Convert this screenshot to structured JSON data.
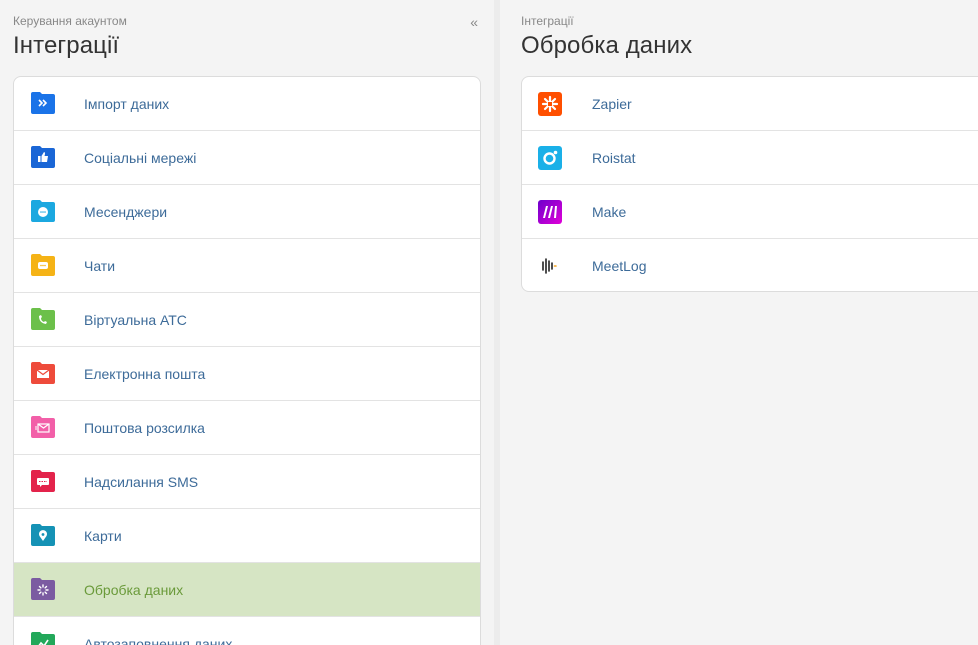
{
  "left": {
    "breadcrumb": "Керування акаунтом",
    "title": "Інтеграції",
    "collapse_icon": "«",
    "items": [
      {
        "label": "Імпорт даних",
        "icon": "import-icon",
        "color": "#1a73e8"
      },
      {
        "label": "Соціальні мережі",
        "icon": "social-icon",
        "color": "#1a66d6"
      },
      {
        "label": "Месенджери",
        "icon": "messenger-icon",
        "color": "#1ba8e0"
      },
      {
        "label": "Чати",
        "icon": "chat-icon",
        "color": "#f5b316"
      },
      {
        "label": "Віртуальна АТС",
        "icon": "phone-icon",
        "color": "#6cc04a"
      },
      {
        "label": "Електронна пошта",
        "icon": "mail-icon",
        "color": "#ee4b3b"
      },
      {
        "label": "Поштова розсилка",
        "icon": "mailing-icon",
        "color": "#f25fa8"
      },
      {
        "label": "Надсилання SMS",
        "icon": "sms-icon",
        "color": "#e3234b"
      },
      {
        "label": "Карти",
        "icon": "map-icon",
        "color": "#1592b5"
      },
      {
        "label": "Обробка даних",
        "icon": "processing-icon",
        "color": "#7b5ba1",
        "active": true
      },
      {
        "label": "Автозаповнення даних",
        "icon": "autofill-icon",
        "color": "#22a85a"
      }
    ]
  },
  "right": {
    "breadcrumb": "Інтеграції",
    "title": "Обробка даних",
    "items": [
      {
        "label": "Zapier",
        "icon": "zapier-icon",
        "color": "#ff4f00"
      },
      {
        "label": "Roistat",
        "icon": "roistat-icon",
        "color": "#1ab0e8"
      },
      {
        "label": "Make",
        "icon": "make-icon",
        "color": "#a30ee0"
      },
      {
        "label": "MeetLog",
        "icon": "meetlog-icon",
        "color": "#222222"
      }
    ]
  }
}
